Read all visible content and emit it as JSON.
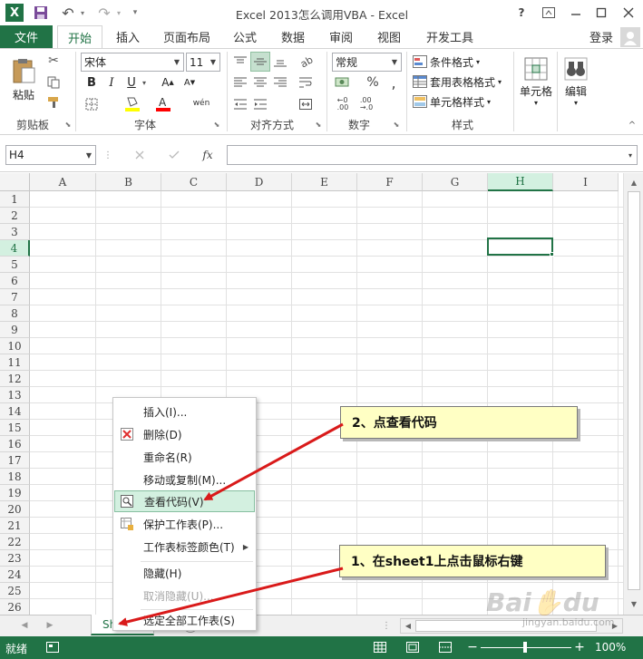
{
  "app": {
    "title": "Excel 2013怎么调用VBA - Excel",
    "window_buttons": [
      "?",
      "⧉",
      "—",
      "☐",
      "✕"
    ],
    "login": "登录"
  },
  "tabs": {
    "file": "文件",
    "items": [
      "开始",
      "插入",
      "页面布局",
      "公式",
      "数据",
      "审阅",
      "视图",
      "开发工具"
    ]
  },
  "ribbon": {
    "clipboard": {
      "label": "剪贴板",
      "paste": "粘贴"
    },
    "font": {
      "label": "字体",
      "name": "宋体",
      "size": "11"
    },
    "alignment": {
      "label": "对齐方式"
    },
    "number": {
      "label": "数字",
      "format": "常规"
    },
    "styles": {
      "label": "样式",
      "items": [
        "条件格式",
        "套用表格格式",
        "单元格样式"
      ]
    },
    "cells": {
      "label": "单元格"
    },
    "editing": {
      "label": "编辑"
    }
  },
  "formula_bar": {
    "name_box": "H4",
    "fx": "fx"
  },
  "grid": {
    "columns": [
      "A",
      "B",
      "C",
      "D",
      "E",
      "F",
      "G",
      "H",
      "I"
    ],
    "rows": [
      "1",
      "2",
      "3",
      "4",
      "5",
      "6",
      "7",
      "8",
      "9",
      "10",
      "11",
      "12",
      "13",
      "14",
      "15",
      "16",
      "17",
      "18",
      "19",
      "20",
      "21",
      "22",
      "23",
      "24",
      "25",
      "26"
    ],
    "selected": "H4"
  },
  "context_menu": {
    "items": [
      {
        "label": "插入(I)..."
      },
      {
        "label": "删除(D)"
      },
      {
        "label": "重命名(R)"
      },
      {
        "label": "移动或复制(M)..."
      },
      {
        "label": "查看代码(V)"
      },
      {
        "label": "保护工作表(P)..."
      },
      {
        "label": "工作表标签颜色(T)"
      },
      {
        "label": "隐藏(H)"
      },
      {
        "label": "取消隐藏(U)..."
      },
      {
        "label": "选定全部工作表(S)"
      }
    ]
  },
  "sheet_tab": "Sh",
  "callouts": {
    "step2": "2、点查看代码",
    "step1": "1、在sheet1上点击鼠标右键"
  },
  "status": {
    "ready": "就绪",
    "zoom": "100%"
  },
  "watermark": "Baidu 经验 jingyan.baidu.com",
  "colors": {
    "excel_green": "#217346",
    "menu_highlight": "#d3f0e0",
    "callout_fill": "#ffffc4",
    "arrow": "#d91a1a"
  }
}
